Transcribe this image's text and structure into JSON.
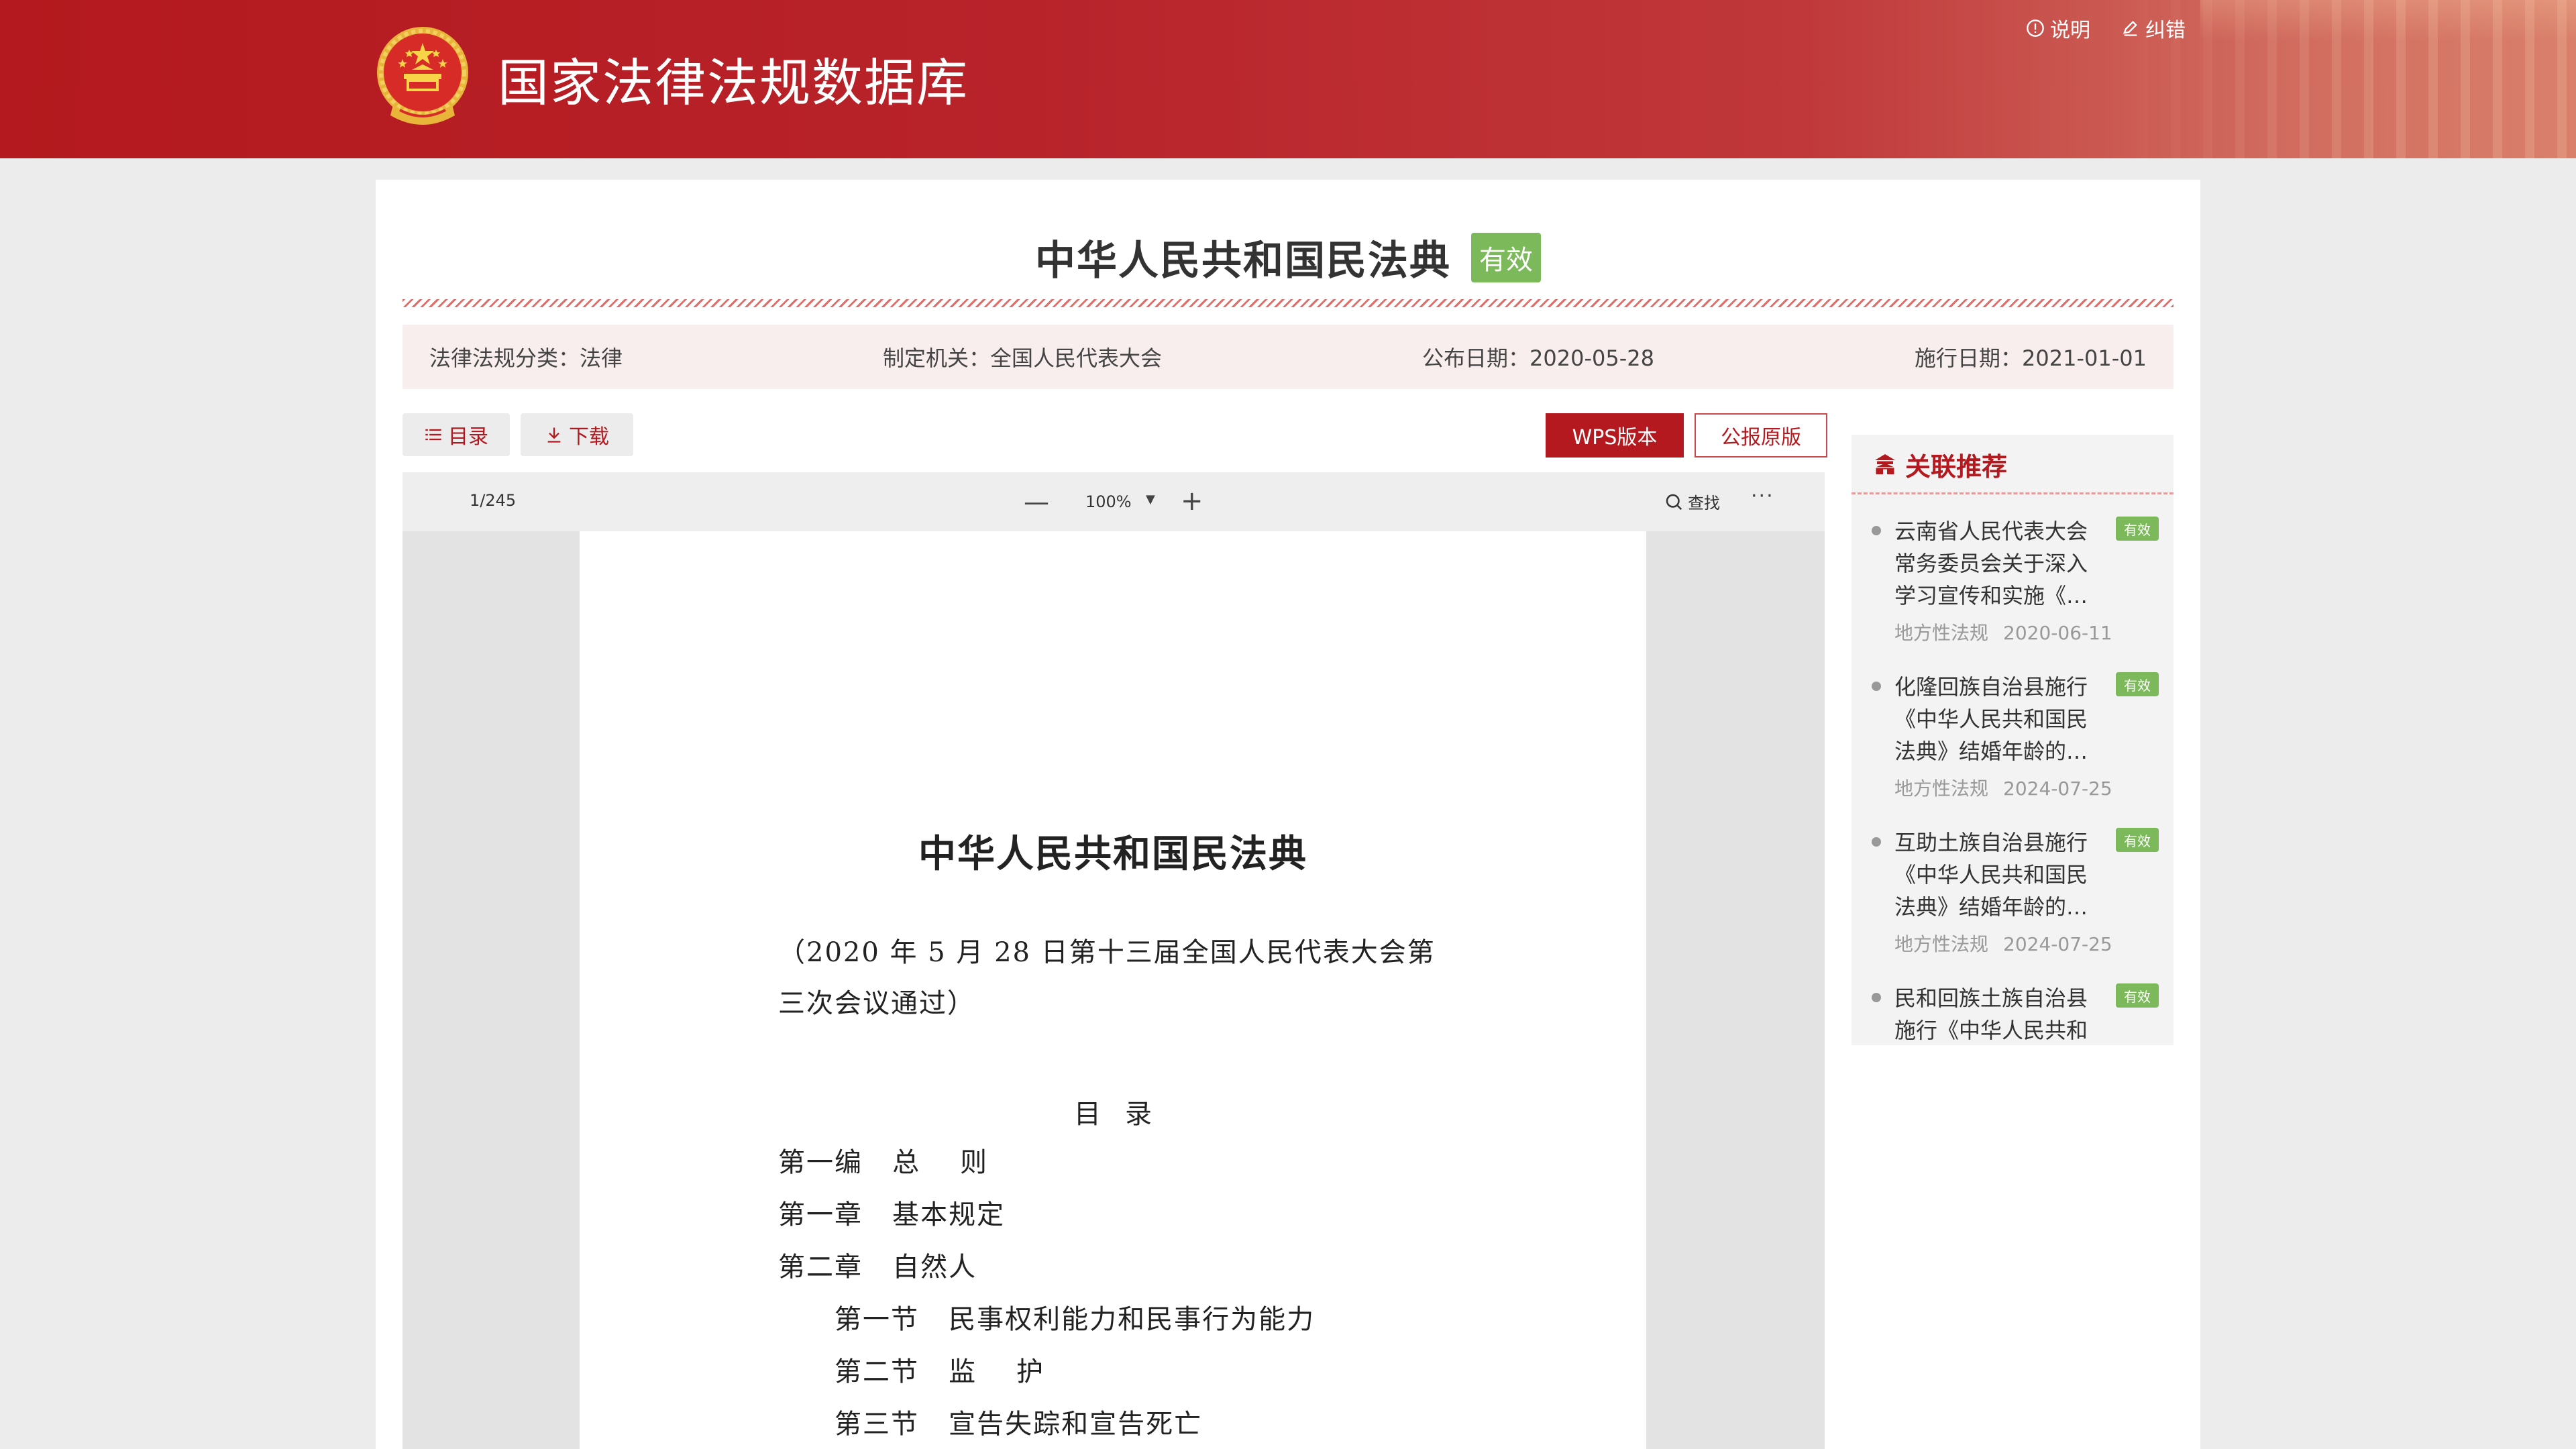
{
  "header": {
    "site_title": "国家法律法规数据库",
    "links": [
      {
        "icon": "info-circle-icon",
        "label": "说明"
      },
      {
        "icon": "edit-icon",
        "label": "纠错"
      }
    ]
  },
  "document": {
    "title": "中华人民共和国民法典",
    "status": "有效",
    "meta": {
      "category": "法律法规分类：法律",
      "authority": "制定机关：全国人民代表大会",
      "publish_date": "公布日期：2020-05-28",
      "effective_date": "施行日期：2021-01-01"
    }
  },
  "toolbar": {
    "toc_label": "目录",
    "download_label": "下载",
    "wps_label": "WPS版本",
    "gazette_label": "公报原版"
  },
  "viewer": {
    "page_indicator": "1/245",
    "zoom_minus": "—",
    "zoom": "100%",
    "zoom_plus": "+",
    "find_label": "查找",
    "more": "···"
  },
  "paper": {
    "title": "中华人民共和国民法典",
    "note": "（2020 年 5 月 28 日第十三届全国人民代表大会第三次会议通过）",
    "toc_heading": "目录",
    "toc": [
      "第一编   总    则",
      "第一章   基本规定",
      "第二章   自然人",
      "第一节   民事权利能力和民事行为能力",
      "第二节   监    护",
      "第三节   宣告失踪和宣告死亡"
    ]
  },
  "sidebar": {
    "heading": "关联推荐",
    "items": [
      {
        "title": "云南省人民代表大会常务委员会关于深入学习宣传和实施《…",
        "status": "有效",
        "category": "地方性法规",
        "date": "2020-06-11"
      },
      {
        "title": "化隆回族自治县施行《中华人民共和国民法典》结婚年龄的…",
        "status": "有效",
        "category": "地方性法规",
        "date": "2024-07-25"
      },
      {
        "title": "互助土族自治县施行《中华人民共和国民法典》结婚年龄的…",
        "status": "有效",
        "category": "地方性法规",
        "date": "2024-07-25"
      },
      {
        "title": "民和回族土族自治县施行《中华人民共和",
        "status": "有效",
        "category": "",
        "date": ""
      }
    ]
  },
  "colors": {
    "brand_red": "#b3191e",
    "valid_green": "#7cb95a"
  }
}
